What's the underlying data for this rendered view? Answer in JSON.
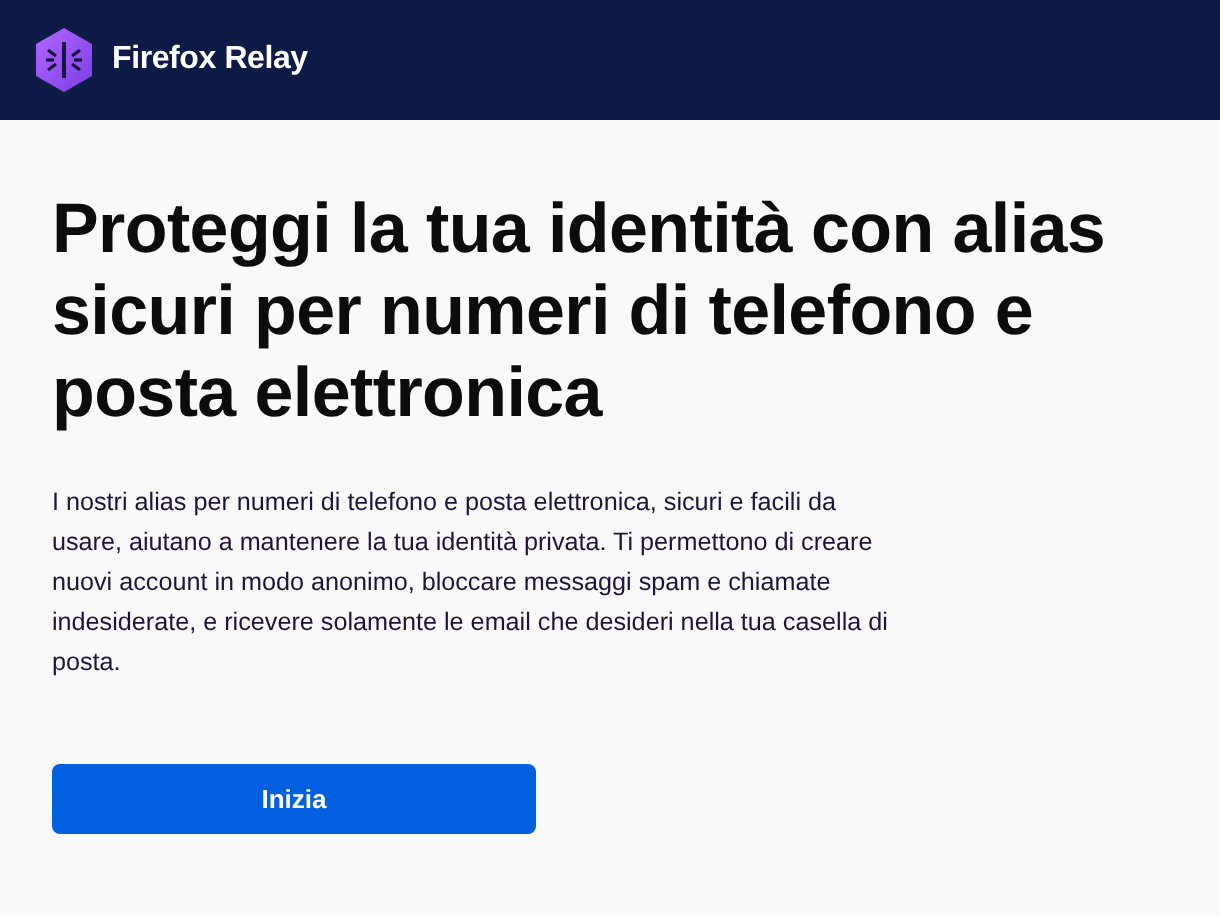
{
  "header": {
    "brand": "Firefox Relay"
  },
  "hero": {
    "title": "Proteggi la tua identità con alias sicuri per numeri di telefono e posta elettronica",
    "description": "I nostri alias per numeri di telefono e posta elettronica, sicuri e facili da usare, aiutano a mantenere la tua identità privata. Ti permettono di creare nuovi account in modo anonimo, bloccare messaggi spam e chiamate indesiderate, e ricevere solamente le email che desideri nella tua casella di posta.",
    "button": "Inizia"
  }
}
